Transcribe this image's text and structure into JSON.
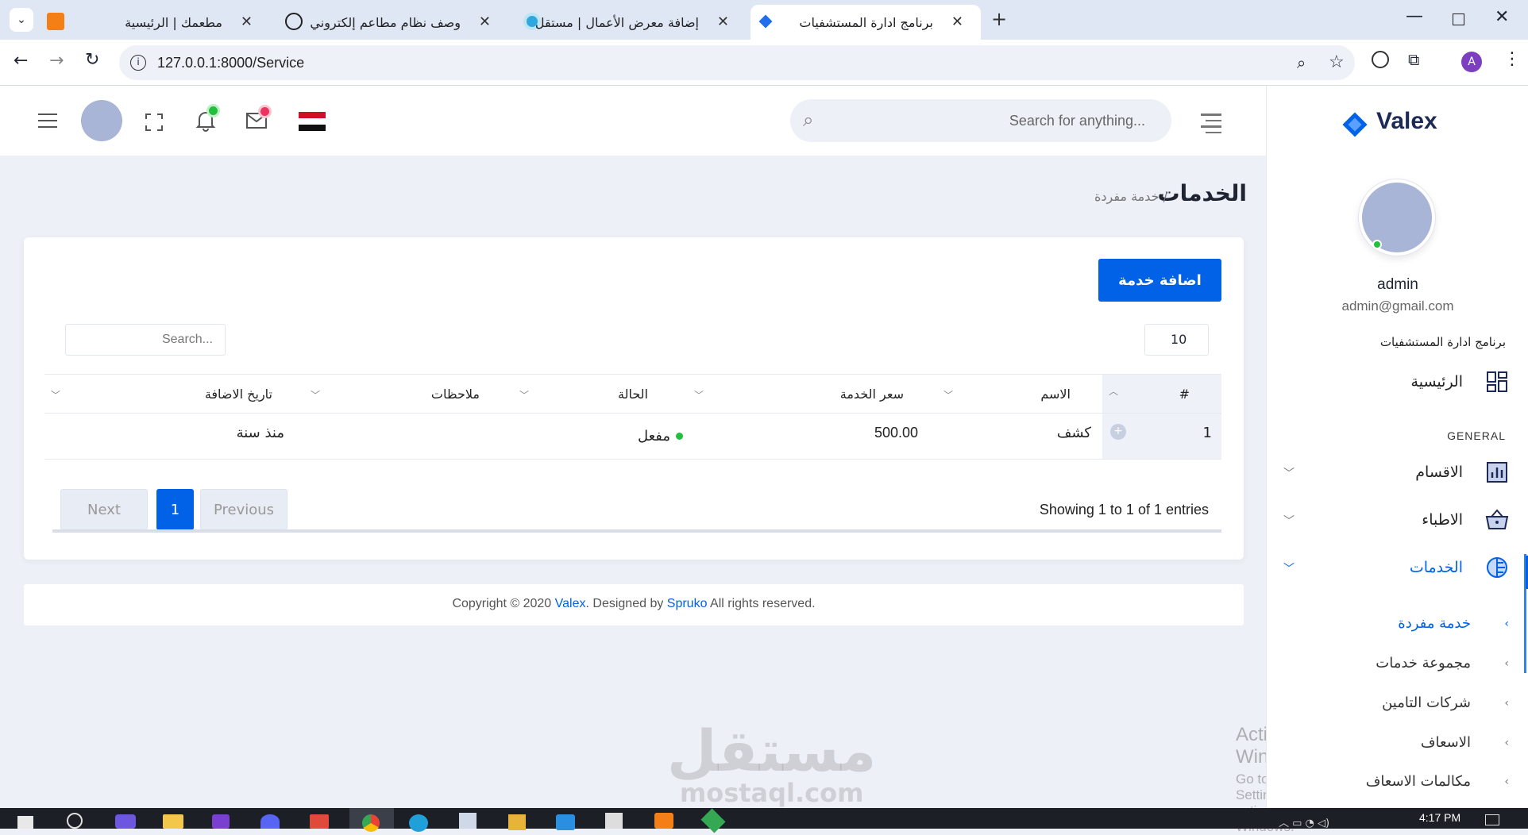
{
  "browser": {
    "tabs": [
      {
        "title": "مطعمك | الرئيسية",
        "active": false
      },
      {
        "title": "وصف نظام مطاعم إلكتروني",
        "active": false
      },
      {
        "title": "إضافة معرض الأعمال | مستقل",
        "active": false
      },
      {
        "title": "برنامج ادارة المستشفيات",
        "active": true
      }
    ],
    "url": "127.0.0.1:8000/Service",
    "profile_initial": "A"
  },
  "header": {
    "search_placeholder": "Search for anything..."
  },
  "page": {
    "title": "الخدمات",
    "breadcrumb": "/ خدمة مفردة"
  },
  "card": {
    "add_button": "اضافة خدمة",
    "page_length": "10",
    "search_placeholder": "Search...",
    "columns": [
      "#",
      "الاسم",
      "سعر الخدمة",
      "الحالة",
      "ملاحظات",
      "تاريخ الاضافة"
    ],
    "rows": [
      {
        "num": "1",
        "name": "كشف",
        "price": "500.00",
        "status": "مفعل",
        "notes": "",
        "date": "منذ سنة"
      }
    ],
    "info": "Showing 1 to 1 of 1 entries",
    "pager": {
      "previous": "Previous",
      "current": "1",
      "next": "Next"
    }
  },
  "footer": {
    "prefix": "Copyright © 2020 ",
    "brand": "Valex",
    "middle": ". Designed by ",
    "designer": "Spruko",
    "suffix": " All rights reserved."
  },
  "sidebar": {
    "logo": "Valex",
    "user_name": "admin",
    "user_email": "admin@gmail.com",
    "app_title": "برنامج ادارة المستشفيات",
    "home": "الرئيسية",
    "section": "GENERAL",
    "items": [
      {
        "label": "الاقسام",
        "icon": "bar-chart-icon"
      },
      {
        "label": "الاطباء",
        "icon": "basket-icon"
      },
      {
        "label": "الخدمات",
        "icon": "pie-icon",
        "active": true
      }
    ],
    "subitems": [
      "خدمة مفردة",
      "مجموعة خدمات",
      "شركات التامين",
      "الاسعاف",
      "مكالمات الاسعاف"
    ]
  },
  "watermark": {
    "activate_title": "Activate Windows",
    "activate_sub": "Go to Settings to activate Windows.",
    "brand_ar": "مستقل",
    "brand_en": "mostaql.com"
  },
  "taskbar": {
    "time": "4:17 PM"
  },
  "colors": {
    "primary": "#0162e8",
    "success": "#22c03c",
    "danger": "#ee335e"
  }
}
